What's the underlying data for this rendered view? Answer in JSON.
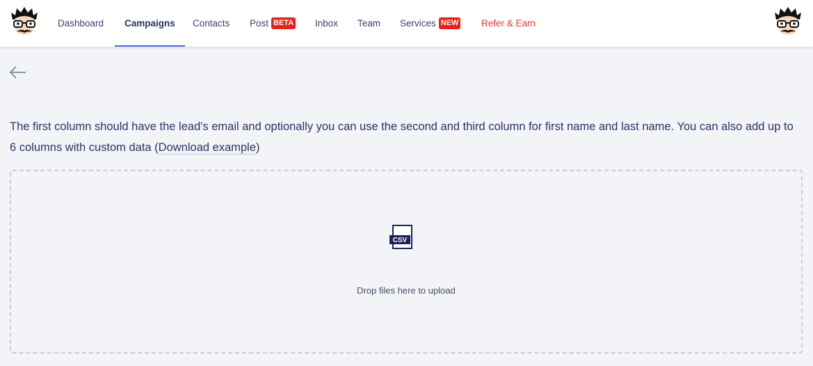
{
  "header": {
    "logo_left": "mascot-logo",
    "logo_right": "user-avatar",
    "nav": {
      "dashboard": "Dashboard",
      "campaigns": "Campaigns",
      "contacts": "Contacts",
      "post": "Post",
      "post_badge": "BETA",
      "inbox": "Inbox",
      "team": "Team",
      "services": "Services",
      "services_badge": "NEW",
      "refer": "Refer & Earn"
    },
    "active_tab": "Campaigns",
    "colors": {
      "accent": "#4d6ae0",
      "badge": "#e8221b",
      "refer": "#e53935",
      "text": "#2d3464"
    }
  },
  "main": {
    "back_icon": "arrow-left-icon",
    "instructions": {
      "text": "The first column should have the lead's email and optionally you can use the second and third column for first name and last name. You can also add up to 6 columns with custom data (",
      "link": "Download example",
      "suffix": ")"
    },
    "dropzone": {
      "icon": "csv-file-icon",
      "icon_label": "CSV",
      "text": "Drop files here to upload"
    }
  }
}
